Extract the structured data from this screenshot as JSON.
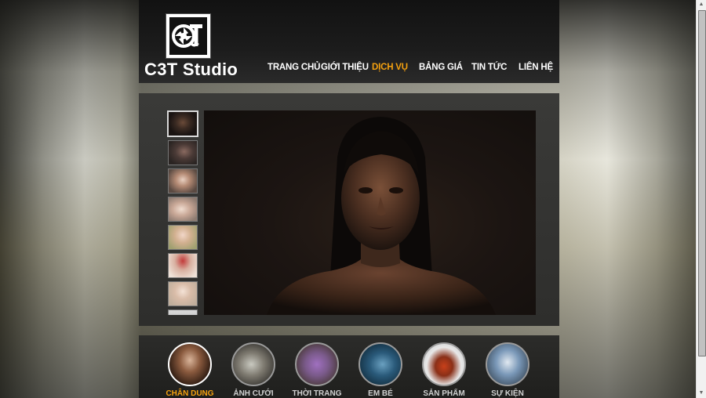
{
  "brand": {
    "name": "C3T Studio"
  },
  "nav": {
    "items": [
      {
        "label": "TRANG CHỦ",
        "active": false
      },
      {
        "label": "GIỚI THIỆU",
        "active": false
      },
      {
        "label": "DỊCH VỤ",
        "active": true
      },
      {
        "label": "BẢNG GIÁ",
        "active": false
      },
      {
        "label": "TIN TỨC",
        "active": false
      },
      {
        "label": "LIÊN HỆ",
        "active": false
      }
    ]
  },
  "gallery": {
    "selected_index": 0,
    "thumbnail_count": 8
  },
  "categories": [
    {
      "label": "CHÂN DUNG",
      "active": true
    },
    {
      "label": "ẢNH CƯỚI",
      "active": false
    },
    {
      "label": "THỜI TRANG",
      "active": false
    },
    {
      "label": "EM BÉ",
      "active": false
    },
    {
      "label": "SẢN PHẨM",
      "active": false
    },
    {
      "label": "SỰ KIỆN",
      "active": false
    }
  ],
  "colors": {
    "accent": "#f5a10f",
    "header_bg": "#1c1c1c",
    "panel_bg": "#333331"
  }
}
